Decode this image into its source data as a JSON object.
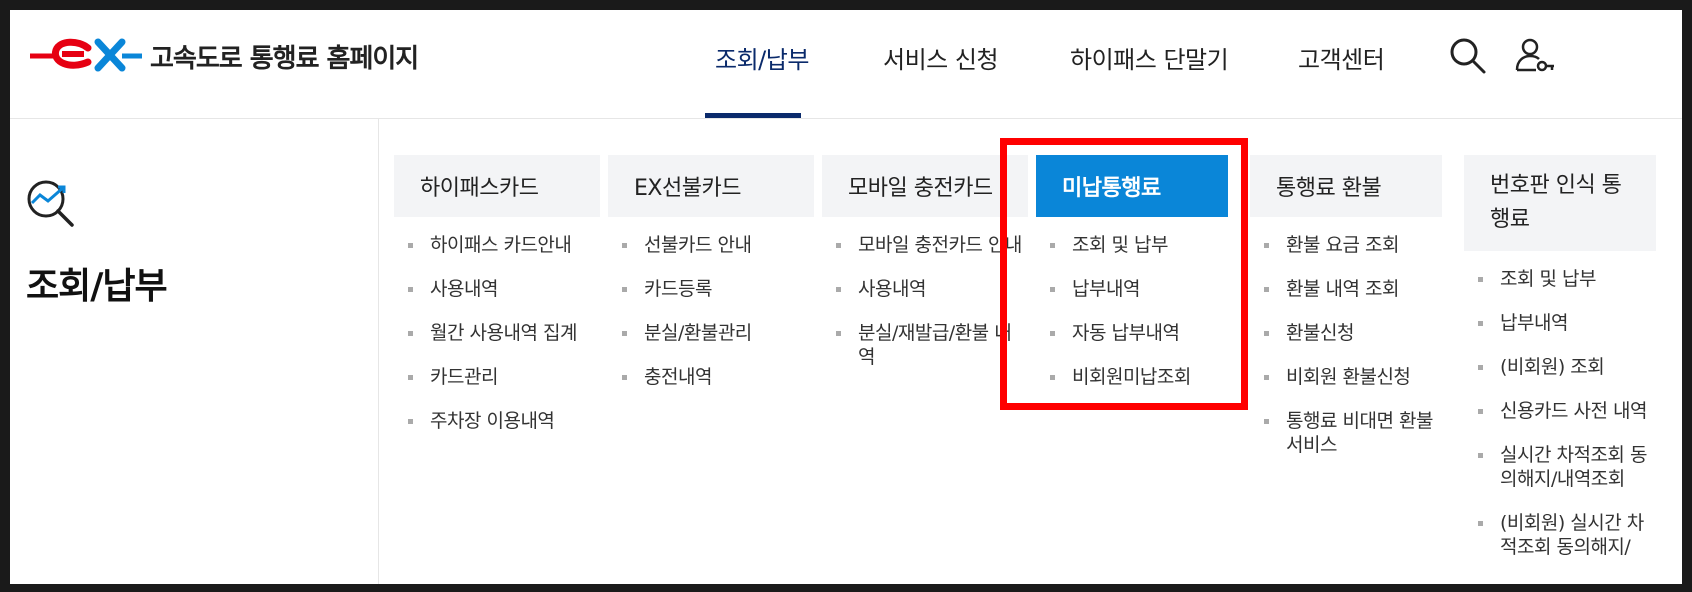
{
  "header": {
    "site_title": "고속도로 통행료 홈페이지",
    "nav": [
      {
        "label": "조회/납부",
        "active": true
      },
      {
        "label": "서비스 신청",
        "active": false
      },
      {
        "label": "하이패스 단말기",
        "active": false
      },
      {
        "label": "고객센터",
        "active": false
      }
    ],
    "icons": [
      "search-icon",
      "user-key-icon"
    ]
  },
  "left_panel": {
    "icon": "magnify-chart-icon",
    "title": "조회/납부"
  },
  "columns": [
    {
      "title": "하이패스카드",
      "items": [
        "하이패스 카드안내",
        "사용내역",
        "월간 사용내역 집계",
        "카드관리",
        "주차장 이용내역"
      ]
    },
    {
      "title": "EX선불카드",
      "items": [
        "선불카드 안내",
        "카드등록",
        "분실/환불관리",
        "충전내역"
      ]
    },
    {
      "title": "모바일 충전카드",
      "items": [
        "모바일 충전카드 안내",
        "사용내역",
        "분실/재발급/환불 내역"
      ]
    },
    {
      "title": "미납통행료",
      "active": true,
      "items": [
        "조회 및 납부",
        "납부내역",
        "자동 납부내역",
        "비회원미납조회"
      ]
    },
    {
      "title": "통행료 환불",
      "items": [
        "환불 요금 조회",
        "환불 내역 조회",
        "환불신청",
        "비회원 환불신청",
        "통행료 비대면 환불서비스"
      ]
    },
    {
      "title": "번호판 인식 통행료",
      "items": [
        "조회 및 납부",
        "납부내역",
        "(비회원) 조회",
        "신용카드 사전 내역",
        "실시간 차적조회 동의해지/내역조회",
        "(비회원) 실시간 차적조회 동의해지/"
      ]
    }
  ],
  "colors": {
    "brand_red": "#e60012",
    "brand_blue": "#0a86d8",
    "nav_active": "#0a2a6b",
    "highlight": "#ff0000"
  }
}
